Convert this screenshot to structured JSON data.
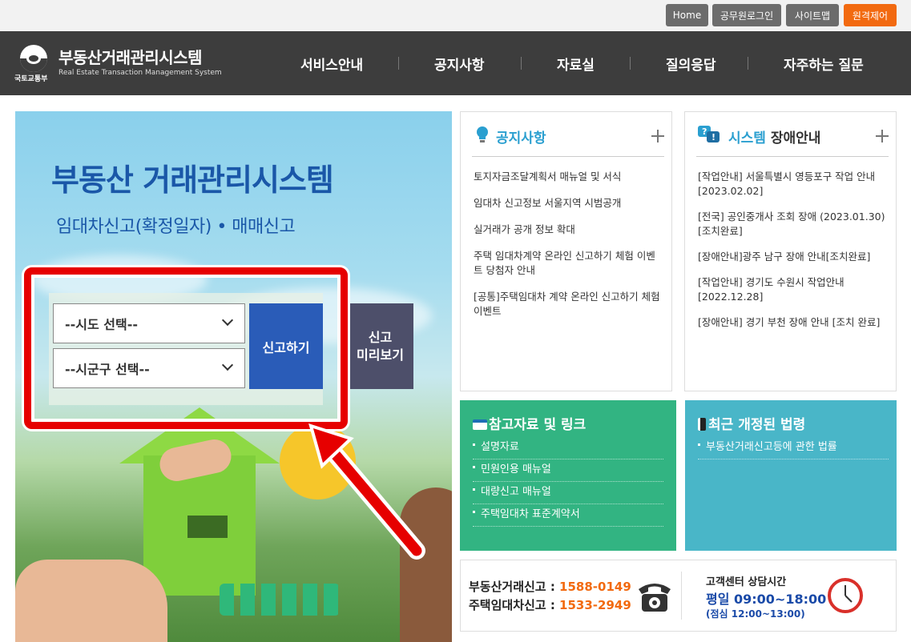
{
  "utility": {
    "home": "Home",
    "login": "공무원로그인",
    "sitemap": "사이트맵",
    "remote": "원격제어"
  },
  "header": {
    "ministry": "국토교통부",
    "title": "부동산거래관리시스템",
    "subtitle": "Real Estate Transaction Management System",
    "nav": [
      "서비스안내",
      "공지사항",
      "자료실",
      "질의응답",
      "자주하는 질문"
    ]
  },
  "hero": {
    "title": "부동산 거래관리시스템",
    "subtitle": "임대차신고(확정일자) • 매매신고",
    "sido_select": "--시도 선택--",
    "sigungu_select": "--시군구 선택--",
    "report_button": "신고하기",
    "preview_line1": "신고",
    "preview_line2": "미리보기"
  },
  "notice": {
    "title": "공지사항",
    "items": [
      "토지자금조달계획서 매뉴얼 및 서식",
      "임대차 신고정보 서울지역 시범공개",
      "실거래가 공개 정보 확대",
      "주택 임대차계약 온라인 신고하기 체험 이벤트 당첨자 안내",
      "[공통]주택임대차 계약 온라인 신고하기 체험 이벤트"
    ]
  },
  "outage": {
    "title_blue": "시스템",
    "title_dark": "장애안내",
    "items": [
      "[작업안내] 서울특별시 영등포구 작업 안내 [2023.02.02]",
      "[전국] 공인중개사 조회 장애 (2023.01.30)[조치완료]",
      "[장애안내]광주 남구 장애 안내[조치완료]",
      "[작업안내] 경기도 수원시 작업안내 [2022.12.28]",
      "[장애안내] 경기 부천 장애 안내 [조치 완료]"
    ]
  },
  "references": {
    "title": "참고자료 및 링크",
    "items": [
      "설명자료",
      "민원인용 매뉴얼",
      "대량신고 매뉴얼",
      "주택임대차 표준계약서"
    ]
  },
  "laws": {
    "title": "최근 개정된 법령",
    "items": [
      "부동산거래신고등에 관한 법률"
    ]
  },
  "contact": {
    "line1_label": "부동산거래신고 : ",
    "line1_number": "1588-0149",
    "line2_label": "주택임대차신고 : ",
    "line2_number": "1533-2949",
    "hours_title": "고객센터 상담시간",
    "hours_main": "평일 09:00~18:00",
    "hours_lunch": "(점심 12:00~13:00)"
  },
  "colors": {
    "header_bg": "#3d3d3d",
    "remote_button": "#f26a10",
    "report_button": "#2a5cb8",
    "references_bg": "#32b482",
    "laws_bg": "#49b6c8",
    "highlight": "#e60000"
  }
}
